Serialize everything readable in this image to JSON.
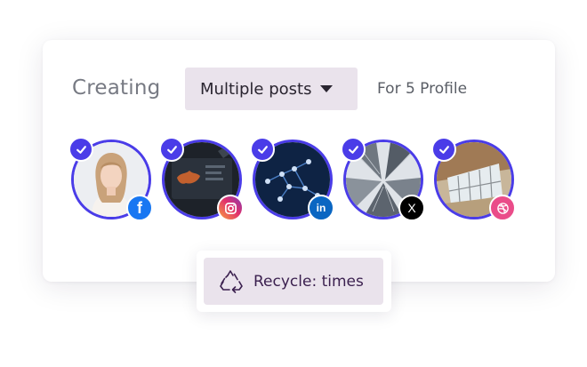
{
  "header": {
    "creating_label": "Creating",
    "mode_dropdown": {
      "selected": "Multiple posts"
    },
    "profile_count_label": "For 5 Profile"
  },
  "profiles": [
    {
      "network": "facebook",
      "badge_text": "f",
      "badge_color": "#1877f2",
      "selected": true
    },
    {
      "network": "instagram",
      "badge_text": "",
      "badge_color": "#e1306c",
      "selected": true
    },
    {
      "network": "linkedin",
      "badge_text": "in",
      "badge_color": "#0a66c2",
      "selected": true
    },
    {
      "network": "x",
      "badge_text": "X",
      "badge_color": "#000000",
      "selected": true
    },
    {
      "network": "dribbble",
      "badge_text": "",
      "badge_color": "#ea4c89",
      "selected": true
    }
  ],
  "recycle": {
    "label": "Recycle: times",
    "icon": "recycle-icon"
  },
  "colors": {
    "accent": "#4a3ce8",
    "chip_bg": "#eae3ec",
    "recycle_text": "#3a1f4e"
  }
}
